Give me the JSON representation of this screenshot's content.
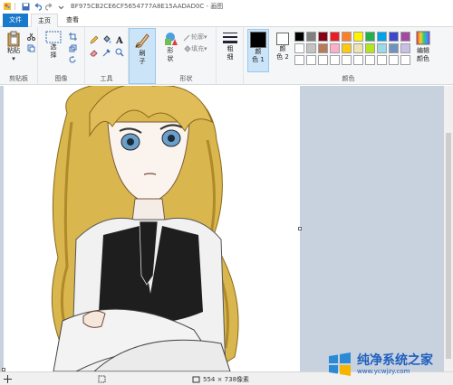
{
  "titlebar": {
    "title": "BF975CB2CE6CF5654777A8E15AADAD0C - 画图"
  },
  "tabs": {
    "file": "文件",
    "home": "主页",
    "view": "查看"
  },
  "ribbon": {
    "clipboard": {
      "paste": "粘贴",
      "group": "剪贴板"
    },
    "image": {
      "select": "选\n择",
      "group": "图像"
    },
    "tools": {
      "group": "工具"
    },
    "brush": {
      "label": "刷\n子"
    },
    "shapes": {
      "shape": "形\n状",
      "outline": "轮廓",
      "fill": "填充",
      "group": "形状"
    },
    "size": {
      "label": "粗\n细"
    },
    "colors": {
      "color1": "颜\n色 1",
      "color2": "颜\n色 2",
      "edit": "编辑\n颜色",
      "group": "颜色"
    }
  },
  "palette": {
    "row1": [
      "#000000",
      "#7f7f7f",
      "#880015",
      "#ed1c24",
      "#ff7f27",
      "#fff200",
      "#22b14c",
      "#00a2e8",
      "#3f48cc",
      "#a349a4"
    ],
    "row2": [
      "#ffffff",
      "#c3c3c3",
      "#b97a57",
      "#ffaec9",
      "#ffc90e",
      "#efe4b0",
      "#b5e61d",
      "#99d9ea",
      "#7092be",
      "#c8bfe7"
    ],
    "row3": [
      "#ffffff",
      "#ffffff",
      "#ffffff",
      "#ffffff",
      "#ffffff",
      "#ffffff",
      "#ffffff",
      "#ffffff",
      "#ffffff",
      "#ffffff"
    ],
    "color1": "#000000",
    "color2": "#ffffff"
  },
  "status": {
    "dimensions": "554 × 738像素"
  },
  "watermark": {
    "main": "纯净系统之家",
    "sub": "www.ycwjzy.com"
  }
}
